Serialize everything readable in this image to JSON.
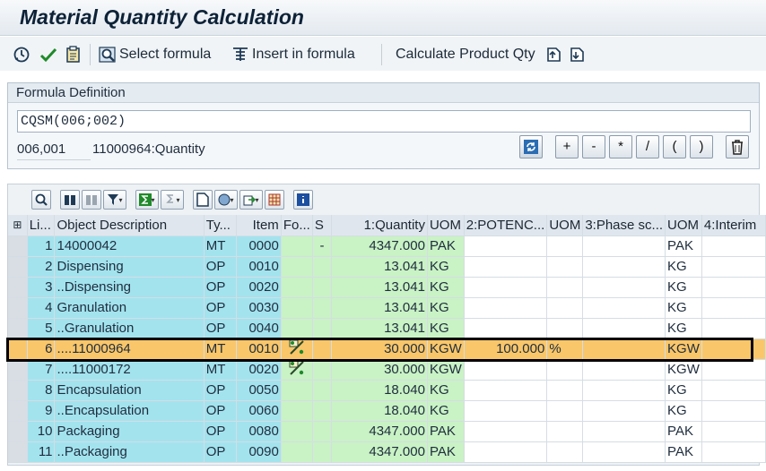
{
  "window": {
    "title": "Material Quantity Calculation"
  },
  "toolbar": {
    "select_formula": "Select formula",
    "insert_formula": "Insert in formula",
    "calculate_qty": "Calculate Product Qty"
  },
  "formula": {
    "section_title": "Formula Definition",
    "expression": "CQSM(006;002)",
    "code": "006,001",
    "description": "11000964:Quantity",
    "operators": [
      "+",
      "-",
      "*",
      "/",
      "(",
      ")"
    ]
  },
  "table": {
    "columns": [
      "Li...",
      "Object Description",
      "Ty...",
      "Item",
      "Fo...",
      "S",
      "1:Quantity",
      "UOM",
      "2:POTENC...",
      "UOM",
      "3:Phase sc...",
      "UOM",
      "4:Interim"
    ],
    "rows": [
      {
        "li": "1",
        "desc": "14000042",
        "ty": "MT",
        "item": "0000",
        "fo": "",
        "s": "-",
        "qty": "4347.000",
        "uom": "PAK",
        "pot": "",
        "uom2": "",
        "phase": "",
        "uom3": "PAK"
      },
      {
        "li": "2",
        "desc": "Dispensing",
        "ty": "OP",
        "item": "0010",
        "fo": "",
        "s": "",
        "qty": "13.041",
        "uom": "KG",
        "pot": "",
        "uom2": "",
        "phase": "",
        "uom3": "KG"
      },
      {
        "li": "3",
        "desc": "..Dispensing",
        "ty": "OP",
        "item": "0020",
        "fo": "",
        "s": "",
        "qty": "13.041",
        "uom": "KG",
        "pot": "",
        "uom2": "",
        "phase": "",
        "uom3": "KG"
      },
      {
        "li": "4",
        "desc": "Granulation",
        "ty": "OP",
        "item": "0030",
        "fo": "",
        "s": "",
        "qty": "13.041",
        "uom": "KG",
        "pot": "",
        "uom2": "",
        "phase": "",
        "uom3": "KG"
      },
      {
        "li": "5",
        "desc": "..Granulation",
        "ty": "OP",
        "item": "0040",
        "fo": "",
        "s": "",
        "qty": "13.041",
        "uom": "KG",
        "pot": "",
        "uom2": "",
        "phase": "",
        "uom3": "KG"
      },
      {
        "li": "6",
        "desc": "....11000964",
        "ty": "MT",
        "item": "0010",
        "fo": "formula-icon",
        "s": "",
        "qty": "30.000",
        "uom": "KGW",
        "pot": "100.000",
        "uom2": "%",
        "phase": "",
        "uom3": "KGW"
      },
      {
        "li": "7",
        "desc": "....11000172",
        "ty": "MT",
        "item": "0020",
        "fo": "formula-icon",
        "s": "",
        "qty": "30.000",
        "uom": "KGW",
        "pot": "",
        "uom2": "",
        "phase": "",
        "uom3": "KGW"
      },
      {
        "li": "8",
        "desc": "Encapsulation",
        "ty": "OP",
        "item": "0050",
        "fo": "",
        "s": "",
        "qty": "18.040",
        "uom": "KG",
        "pot": "",
        "uom2": "",
        "phase": "",
        "uom3": "KG"
      },
      {
        "li": "9",
        "desc": "..Encapsulation",
        "ty": "OP",
        "item": "0060",
        "fo": "",
        "s": "",
        "qty": "18.040",
        "uom": "KG",
        "pot": "",
        "uom2": "",
        "phase": "",
        "uom3": "KG"
      },
      {
        "li": "10",
        "desc": "Packaging",
        "ty": "OP",
        "item": "0080",
        "fo": "",
        "s": "",
        "qty": "4347.000",
        "uom": "PAK",
        "pot": "",
        "uom2": "",
        "phase": "",
        "uom3": "PAK"
      },
      {
        "li": "11",
        "desc": "..Packaging",
        "ty": "OP",
        "item": "0090",
        "fo": "",
        "s": "",
        "qty": "4347.000",
        "uom": "PAK",
        "pot": "",
        "uom2": "",
        "phase": "",
        "uom3": "PAK"
      }
    ],
    "highlighted_row": 6
  },
  "colors": {
    "blue_cell": "#a3e3ee",
    "green_cell": "#c9f2c5",
    "highlight": "#f9c66a"
  }
}
